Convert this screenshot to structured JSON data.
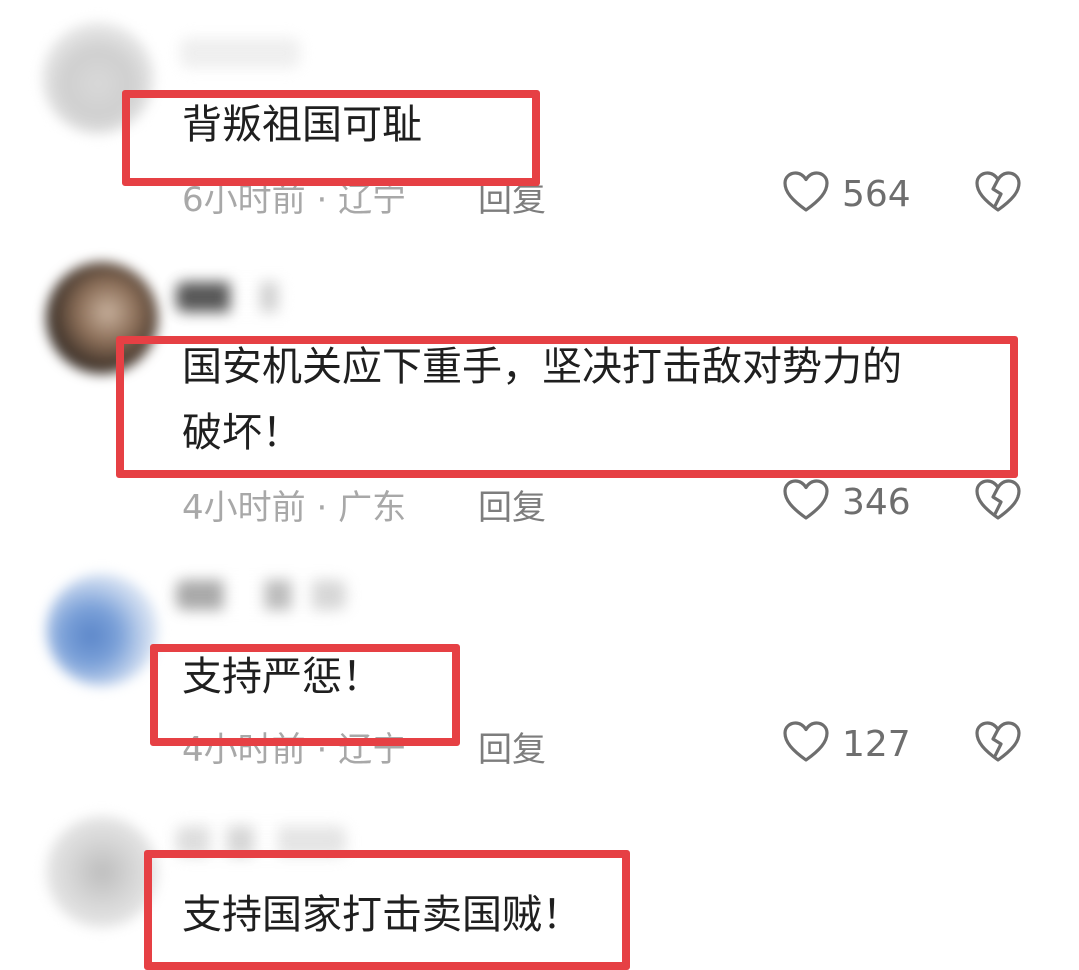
{
  "comments": [
    {
      "text": "背叛祖国可耻",
      "time": "6小时前",
      "location": "辽宁",
      "reply_label": "回复",
      "likes": "564"
    },
    {
      "text_line1": "国安机关应下重手，坚决打击敌对势力的",
      "text_line2": "破坏！",
      "time": "4小时前",
      "location": "广东",
      "reply_label": "回复",
      "likes": "346"
    },
    {
      "text": "支持严惩！",
      "time": "4小时前",
      "location": "辽宁",
      "reply_label": "回复",
      "likes": "127"
    },
    {
      "text": "支持国家打击卖国贼！"
    }
  ],
  "meta_separator": "·",
  "colors": {
    "highlight_box": "#e64044",
    "comment_text": "#1f1f1f",
    "meta_text": "#a8a8a8",
    "icon_gray": "#6e6e6e"
  },
  "icons": {
    "like": "heart-outline-icon",
    "dislike": "broken-heart-icon"
  }
}
